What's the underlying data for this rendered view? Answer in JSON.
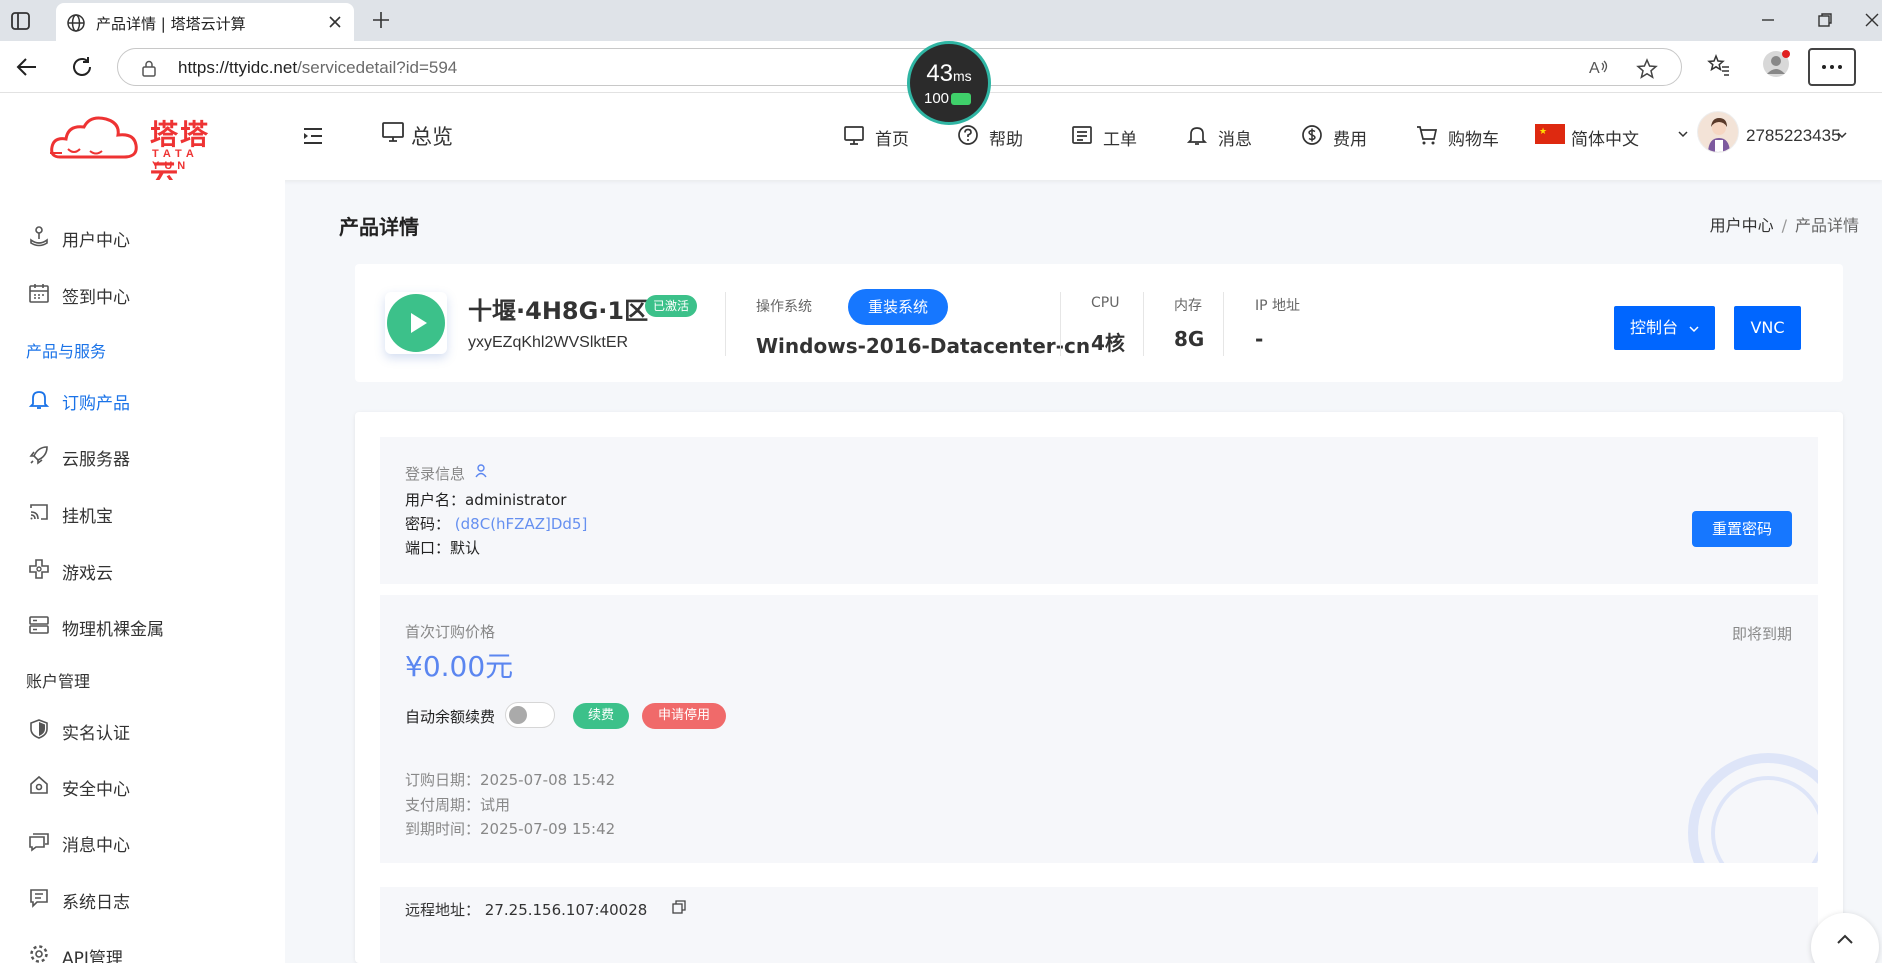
{
  "browser": {
    "tab_title": "产品详情 | 塔塔云计算",
    "url_domain": "https://ttyidc.net",
    "url_path": "/servicedetail?id=594",
    "ping_ms": "43",
    "ping_unit": "ms",
    "battery": "100"
  },
  "header": {
    "logo_cn": "塔塔云",
    "logo_en": "TATA YUN",
    "overview": "总览",
    "nav": [
      "首页",
      "帮助",
      "工单",
      "消息",
      "费用",
      "购物车"
    ],
    "language": "简体中文",
    "username": "2785223435"
  },
  "sidebar": {
    "items_top": [
      "用户中心",
      "签到中心"
    ],
    "group_products": "产品与服务",
    "items_products": [
      "订购产品",
      "云服务器",
      "挂机宝",
      "游戏云",
      "物理机裸金属"
    ],
    "group_account": "账户管理",
    "items_account": [
      "实名认证",
      "安全中心",
      "消息中心",
      "系统日志",
      "API管理"
    ]
  },
  "page": {
    "title": "产品详情",
    "breadcrumb": [
      "用户中心",
      "/",
      "产品详情"
    ]
  },
  "product": {
    "name": "十堰·4H8G·1区",
    "status": "已激活",
    "hostname": "yxyEZqKhl2WVSlktER",
    "os_label": "操作系统",
    "reinstall_button": "重装系统",
    "os_value": "Windows-2016-Datacenter-cn",
    "cpu_label": "CPU",
    "cpu_value": "4核",
    "mem_label": "内存",
    "mem_value": "8G",
    "ip_label": "IP 地址",
    "ip_value": "-",
    "console_button": "控制台",
    "vnc_button": "VNC"
  },
  "login": {
    "title": "登录信息",
    "username_label": "用户名：",
    "username_value": "administrator",
    "password_label": "密码：",
    "password_value": "(d8C(hFZAZ]Dd5]",
    "port_label": "端口：",
    "port_value": "默认",
    "reset_button": "重置密码"
  },
  "billing": {
    "first_price_label": "首次订购价格",
    "first_price_value": "¥0.00元",
    "status_text": "即将到期",
    "auto_renew_label": "自动余额续费",
    "auto_renew_on": false,
    "renew_button": "续费",
    "stop_button": "申请停用",
    "order_date": "订购日期：2025-07-08 15:42",
    "pay_cycle": "支付周期：试用",
    "expire_time": "到期时间：2025-07-09 15:42"
  },
  "remote": {
    "label": "远程地址：",
    "value": "27.25.156.107:40028"
  },
  "colors": {
    "primary": "#1677ff",
    "button_blue": "#0066ff",
    "success": "#3cc18a",
    "danger": "#f06a6a",
    "price": "#5b86f0",
    "logo_red": "#e33333"
  }
}
